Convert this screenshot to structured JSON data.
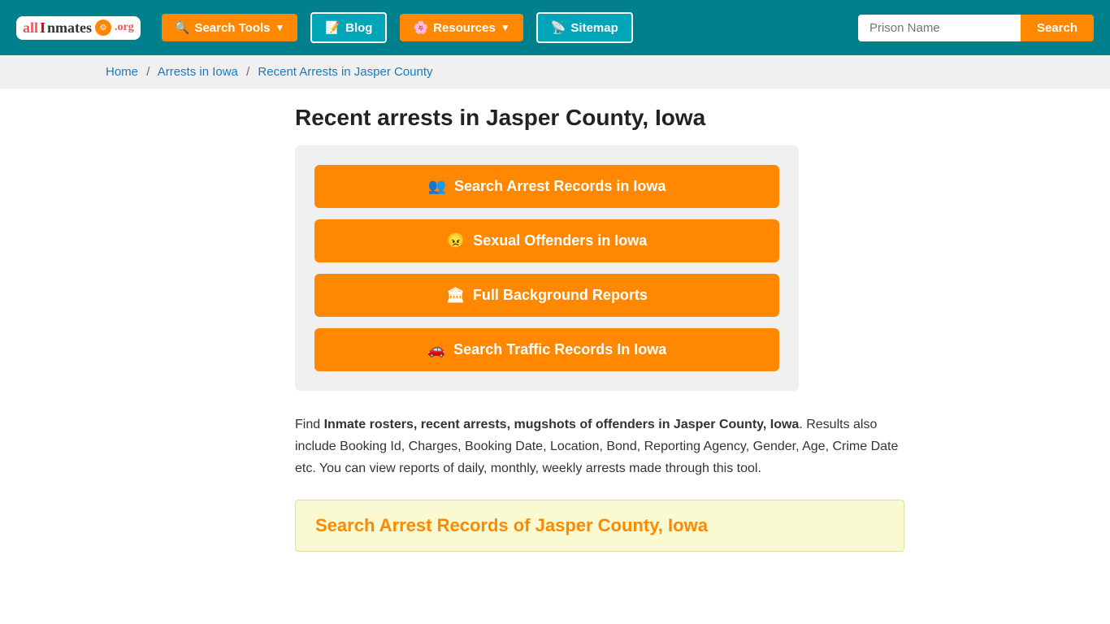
{
  "header": {
    "logo": {
      "all": "all",
      "inmates": "Inmates",
      "org": ".org"
    },
    "nav": [
      {
        "id": "search-tools",
        "label": "Search Tools",
        "icon": "🔍",
        "dropdown": true
      },
      {
        "id": "blog",
        "label": "Blog",
        "icon": "📝",
        "dropdown": false
      },
      {
        "id": "resources",
        "label": "Resources",
        "icon": "🌸",
        "dropdown": true
      },
      {
        "id": "sitemap",
        "label": "Sitemap",
        "icon": "📡",
        "dropdown": false
      }
    ],
    "search_placeholder": "Prison Name",
    "search_button": "Search"
  },
  "breadcrumb": {
    "items": [
      {
        "label": "Home",
        "link": true
      },
      {
        "label": "Arrests in Iowa",
        "link": true
      },
      {
        "label": "Recent Arrests in Jasper County",
        "link": false
      }
    ]
  },
  "main": {
    "page_title": "Recent arrests in Jasper County, Iowa",
    "action_buttons": [
      {
        "id": "search-arrest",
        "label": "Search Arrest Records in Iowa",
        "icon": "👥"
      },
      {
        "id": "sexual-offenders",
        "label": "Sexual Offenders in Iowa",
        "icon": "😠"
      },
      {
        "id": "background-reports",
        "label": "Full Background Reports",
        "icon": "🏛"
      },
      {
        "id": "traffic-records",
        "label": "Search Traffic Records In Iowa",
        "icon": "🚗"
      }
    ],
    "description": {
      "prefix": "Find ",
      "bold_text": "Inmate rosters, recent arrests, mugshots of offenders in Jasper County, Iowa",
      "suffix": ". Results also include Booking Id, Charges, Booking Date, Location, Bond, Reporting Agency, Gender, Age, Crime Date etc. You can view reports of daily, monthly, weekly arrests made through this tool."
    },
    "section_title": "Search Arrest Records of Jasper County, Iowa"
  }
}
